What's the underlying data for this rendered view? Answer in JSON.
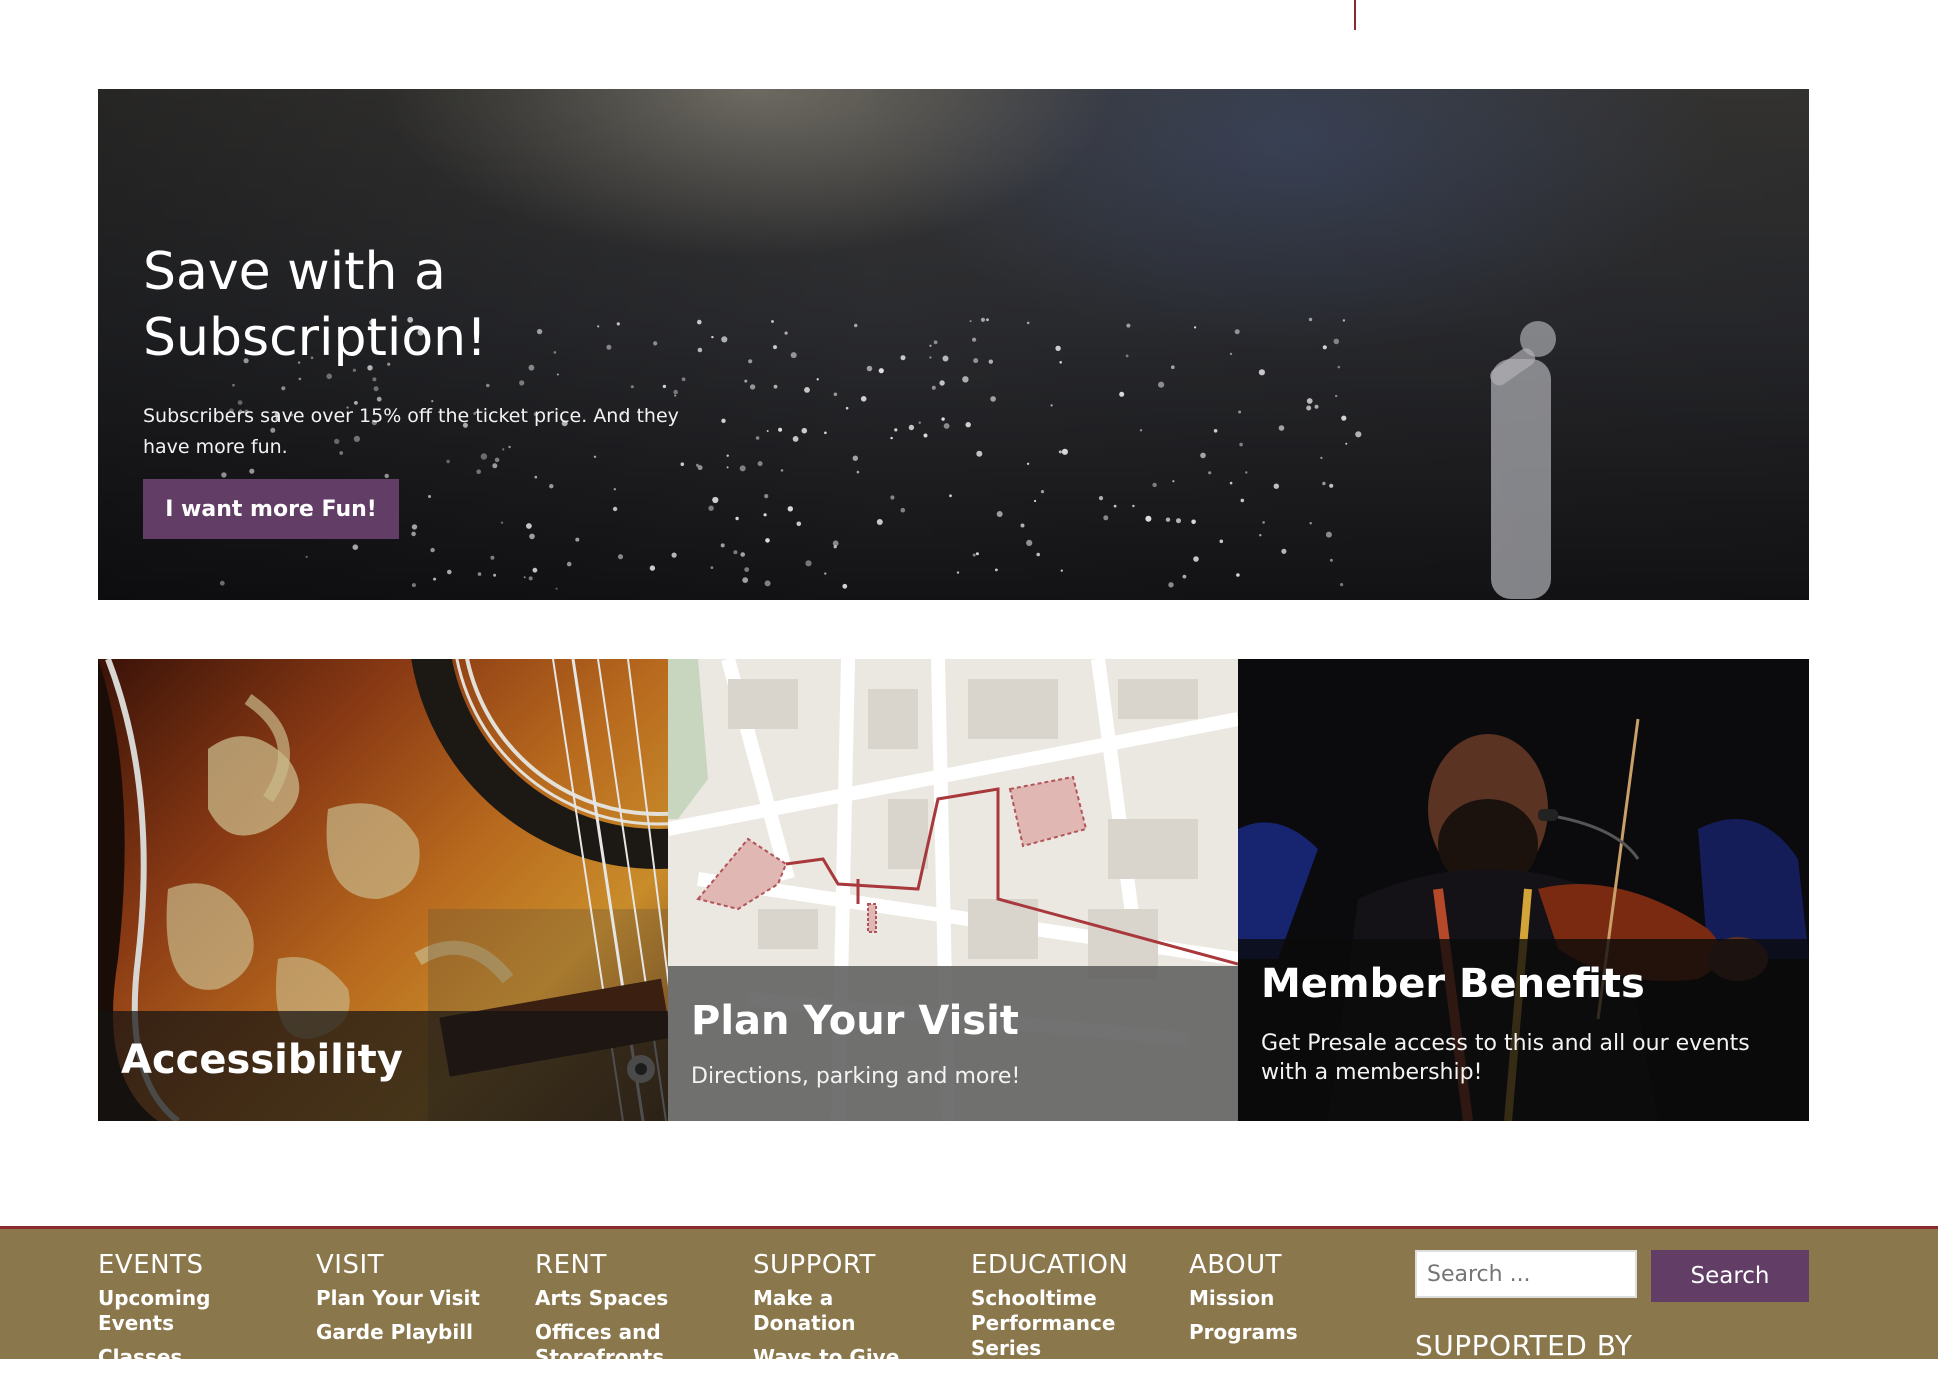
{
  "hero": {
    "title": "Save with a Subscription!",
    "text": "Subscribers save over 15% off the ticket price. And they have more fun.",
    "button_label": "I want more Fun!"
  },
  "cards": [
    {
      "title": "Accessibility",
      "text": ""
    },
    {
      "title": "Plan Your Visit",
      "text": "Directions, parking and more!"
    },
    {
      "title": "Member Benefits",
      "text": "Get Presale access to this and all our events with a membership!"
    }
  ],
  "footer": {
    "columns": [
      {
        "heading": "EVENTS",
        "links": [
          "Upcoming Events",
          "Classes"
        ]
      },
      {
        "heading": "VISIT",
        "links": [
          "Plan Your Visit",
          "Garde Playbill"
        ]
      },
      {
        "heading": "RENT",
        "links": [
          "Arts Spaces",
          "Offices and Storefronts"
        ]
      },
      {
        "heading": "SUPPORT",
        "links": [
          "Make a Donation",
          "Ways to Give"
        ]
      },
      {
        "heading": "EDUCATION",
        "links": [
          "Schooltime Performance Series"
        ]
      },
      {
        "heading": "ABOUT",
        "links": [
          "Mission",
          "Programs"
        ]
      }
    ],
    "search": {
      "placeholder": "Search ...",
      "button_label": "Search"
    },
    "supported_by": "SUPPORTED BY"
  },
  "colors": {
    "accent_purple": "#623d66",
    "footer_bg": "#8a774c",
    "divider_red": "#8b2a2f"
  }
}
